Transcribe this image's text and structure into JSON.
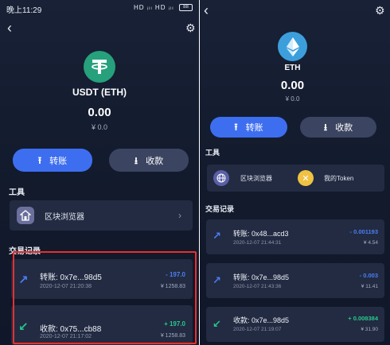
{
  "status_bar": {
    "time": "晚上11:29",
    "icons_text": "HD ᵢₗₗ HD ᵢₗₗ",
    "battery": "88"
  },
  "left": {
    "coin_name": "USDT (ETH)",
    "balance": "0.00",
    "fiat": "¥ 0.0",
    "send_label": "转账",
    "receive_label": "收款",
    "tools_title": "工具",
    "tools": [
      {
        "label": "区块浏览器",
        "icon": "browser-icon"
      }
    ],
    "tx_title": "交易记录",
    "transactions": [
      {
        "title": "转账: 0x7e...98d5",
        "time": "2020-12-07 21:20:38",
        "amount": "- 197.0",
        "fiat": "¥ 1258.83",
        "direction": "out"
      },
      {
        "title": "收款: 0x75...cb88",
        "time": "2020-12-07 21:17:02",
        "amount": "+ 197.0",
        "fiat": "¥ 1258.83",
        "direction": "in"
      }
    ]
  },
  "right": {
    "coin_name": "ETH",
    "balance": "0.00",
    "fiat": "¥ 0.0",
    "send_label": "转账",
    "receive_label": "收款",
    "tools_title": "工具",
    "tools": [
      {
        "label": "区块浏览器",
        "icon": "globe-icon"
      },
      {
        "label": "我的Token",
        "icon": "token-icon"
      }
    ],
    "tx_title": "交易记录",
    "transactions": [
      {
        "title": "转账: 0x48...acd3",
        "time": "2020-12-07 21:44:31",
        "amount": "- 0.001193",
        "fiat": "¥ 4.54",
        "direction": "out"
      },
      {
        "title": "转账: 0x7e...98d5",
        "time": "2020-12-07 21:43:36",
        "amount": "- 0.003",
        "fiat": "¥ 11.41",
        "direction": "out"
      },
      {
        "title": "收款: 0x7e...98d5",
        "time": "2020-12-07 21:19:07",
        "amount": "+ 0.008384",
        "fiat": "¥ 31.90",
        "direction": "in"
      }
    ]
  },
  "colors": {
    "background": "#141c2f",
    "card": "#222b42",
    "primary_button": "#3e6ef0",
    "secondary_button": "#3b4460",
    "outgoing": "#4c7df5",
    "incoming": "#27c48a",
    "highlight_box": "#e8302c",
    "usdt": "#26a17b",
    "eth": "#3c9fdc"
  }
}
